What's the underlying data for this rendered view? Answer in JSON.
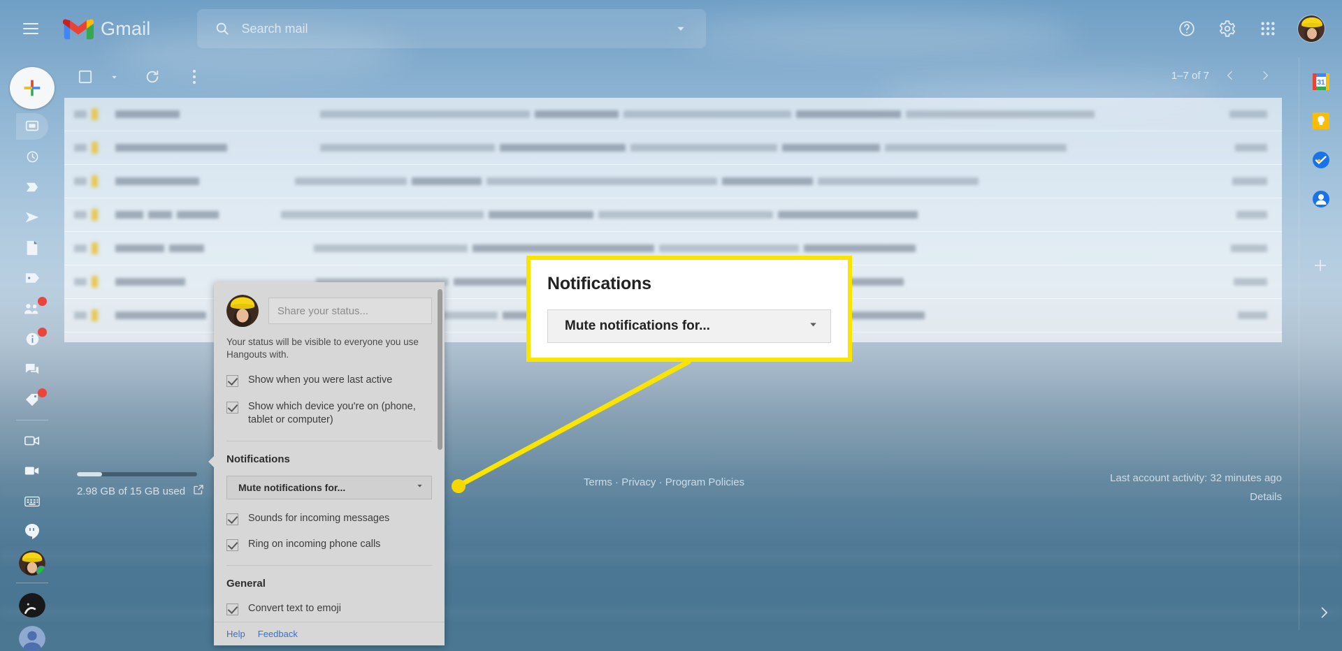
{
  "header": {
    "menu_label": "Main menu",
    "brand": "Gmail",
    "search_placeholder": "Search mail",
    "search_value": "",
    "icons": {
      "hamburger": "hamburger-icon",
      "search": "search-icon",
      "search_options": "chevron-down-icon",
      "help": "help-icon",
      "settings": "gear-icon",
      "apps": "apps-grid-icon",
      "avatar": "account-avatar"
    }
  },
  "toolbar": {
    "select_all_label": "Select",
    "refresh_label": "Refresh",
    "more_label": "More",
    "pagination": "1–7 of 7",
    "prev_label": "Newer",
    "next_label": "Older"
  },
  "left_rail": {
    "compose_label": "Compose",
    "items": [
      {
        "name": "chat-rooms",
        "badge": false,
        "selected": true
      },
      {
        "name": "snoozed-clock",
        "badge": false,
        "selected": false
      },
      {
        "name": "important-marker",
        "badge": false,
        "selected": false
      },
      {
        "name": "sent-paperplane",
        "badge": false,
        "selected": false
      },
      {
        "name": "drafts-file",
        "badge": false,
        "selected": false
      },
      {
        "name": "label-tag",
        "badge": false,
        "selected": false
      },
      {
        "name": "people-group",
        "badge": true,
        "selected": false
      },
      {
        "name": "info-circle",
        "badge": true,
        "selected": false
      },
      {
        "name": "chat-bubble",
        "badge": false,
        "selected": false
      },
      {
        "name": "offer-tag",
        "badge": true,
        "selected": false
      },
      {
        "name": "video-outline",
        "badge": false,
        "selected": false
      },
      {
        "name": "video-solid",
        "badge": false,
        "selected": false
      },
      {
        "name": "dialpad",
        "badge": false,
        "selected": false
      },
      {
        "name": "hangouts-quote",
        "badge": false,
        "selected": false
      }
    ]
  },
  "right_rail": {
    "items": [
      {
        "name": "google-calendar-icon",
        "label": "Calendar",
        "day": "31"
      },
      {
        "name": "google-keep-icon",
        "label": "Keep"
      },
      {
        "name": "google-tasks-icon",
        "label": "Tasks"
      },
      {
        "name": "google-contacts-icon",
        "label": "Contacts"
      },
      {
        "name": "get-addons-plus-icon",
        "label": "Get add-ons"
      }
    ],
    "expand_label": "Show side panel"
  },
  "footer": {
    "storage_text": "2.98 GB of 15 GB used",
    "storage_percent": 20,
    "manage_icon": "open-in-new-icon",
    "links": [
      "Terms",
      "Privacy",
      "Program Policies"
    ],
    "separator": "·",
    "activity": "Last account activity: 32 minutes ago",
    "details": "Details"
  },
  "hangouts_panel": {
    "status_placeholder": "Share your status...",
    "status_value": "",
    "note": "Your status will be visible to everyone you use Hangouts with.",
    "presence_options": [
      {
        "label": "Show when you were last active",
        "checked": true
      },
      {
        "label": "Show which device you're on (phone, tablet or computer)",
        "checked": true
      }
    ],
    "notifications_title": "Notifications",
    "mute_select_label": "Mute notifications for...",
    "notification_options": [
      {
        "label": "Sounds for incoming messages",
        "checked": true
      },
      {
        "label": "Ring on incoming phone calls",
        "checked": true
      }
    ],
    "general_title": "General",
    "general_options": [
      {
        "label": "Convert text to emoji",
        "checked": true
      }
    ],
    "footer_links": [
      "Help",
      "Feedback"
    ]
  },
  "callout": {
    "title": "Notifications",
    "select_label": "Mute notifications for...",
    "border_color": "#fbe400",
    "line_color": "#fbe400",
    "dot_color": "#f5d800"
  }
}
